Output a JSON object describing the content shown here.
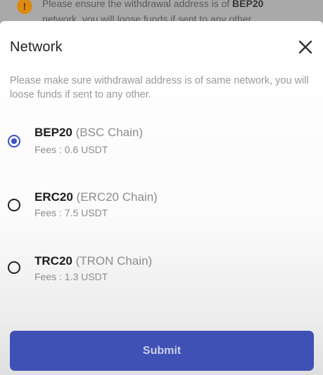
{
  "banner": {
    "line1_prefix": "Please ensure the withdrawal address is of ",
    "line1_bold": "BEP20",
    "line2": "network, you will loose funds if sent to any other."
  },
  "sheet": {
    "title": "Network",
    "notice": "Please make sure withdrawal address is of same network, you will loose funds if sent to any other.",
    "options": [
      {
        "name": "BEP20",
        "chain": "(BSC Chain)",
        "fees": "Fees : 0.6 USDT",
        "selected": true
      },
      {
        "name": "ERC20",
        "chain": "(ERC20 Chain)",
        "fees": "Fees : 7.5 USDT",
        "selected": false
      },
      {
        "name": "TRC20",
        "chain": "(TRON Chain)",
        "fees": "Fees : 1.3 USDT",
        "selected": false
      }
    ],
    "submit_label": "Submit"
  },
  "colors": {
    "accent": "#3f51b5",
    "radio_selected": "#3f51c9",
    "muted_text": "#8d8d8d",
    "warning": "#d98b12"
  },
  "icons": {
    "warning": "info-warning-icon",
    "close": "close-icon"
  }
}
